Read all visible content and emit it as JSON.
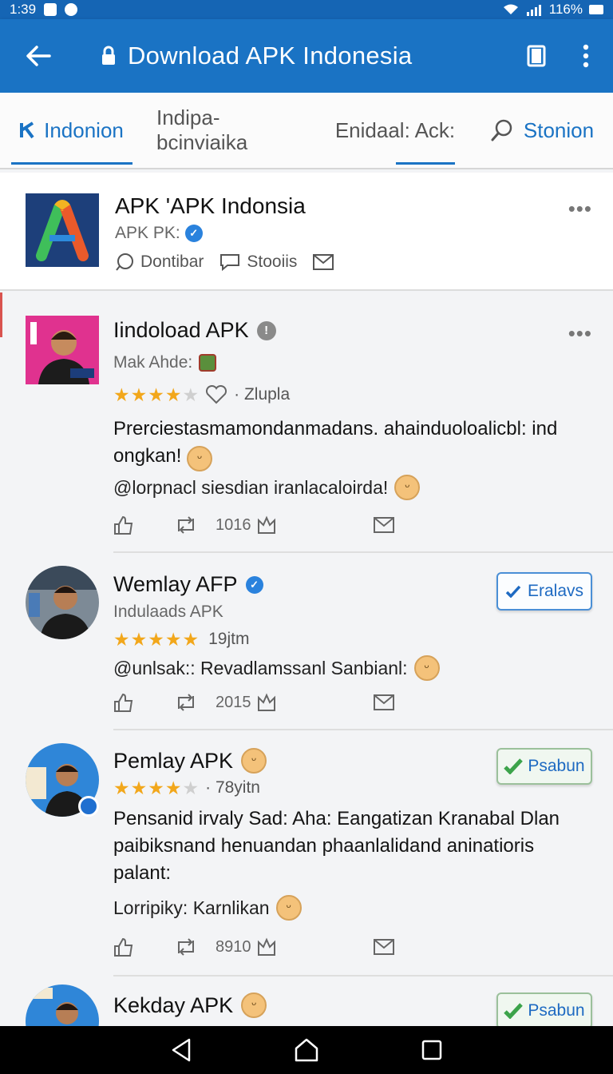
{
  "status_bar": {
    "time": "1:39",
    "battery": "116%"
  },
  "app_bar": {
    "title": "Download APK Indonesia"
  },
  "tabs": [
    {
      "label": "Indonion"
    },
    {
      "label": "Indipa-bcinviaika"
    },
    {
      "label": "Enidaal: Ack:"
    },
    {
      "label": "Stonion"
    }
  ],
  "page": {
    "name": "APK 'APK Indonsia",
    "subtitle": "APK PK:",
    "actions": [
      "Dontibar",
      "Stooiis"
    ]
  },
  "posts": [
    {
      "name": "Iindoload APK",
      "sub": "Mak Ahde:",
      "rating": 4,
      "meta": "· Zlupla",
      "text": "Prerciestasmamondanmadans. ahainduoloalicbl: ind ongkan!",
      "line2": "@lorpnacl siesdian iranlacaloirda!",
      "count": "1016"
    },
    {
      "name": "Wemlay AFP",
      "sub": "Indulaads APK",
      "rating": 5,
      "meta": "19jtm",
      "text": "@unlsak:: Revadlamssanl Sanbianl:",
      "count": "2015",
      "button": "Eralavs"
    },
    {
      "name": "Pemlay APK",
      "rating": 4,
      "meta": "· 78yitn",
      "text": "Pensanid irvaly Sad: Aha: Eangatizan Kranabal Dlan paibiksnand henuandan phaanlalidand aninatioris palant:",
      "line2": "Lorripiky: Karnlikan",
      "count": "8910",
      "button": "Psabun"
    },
    {
      "name": "Kekday APK",
      "button": "Psabun"
    }
  ],
  "colors": {
    "primary": "#1a73c4",
    "status": "#1565b4",
    "star": "#f2a71b"
  }
}
